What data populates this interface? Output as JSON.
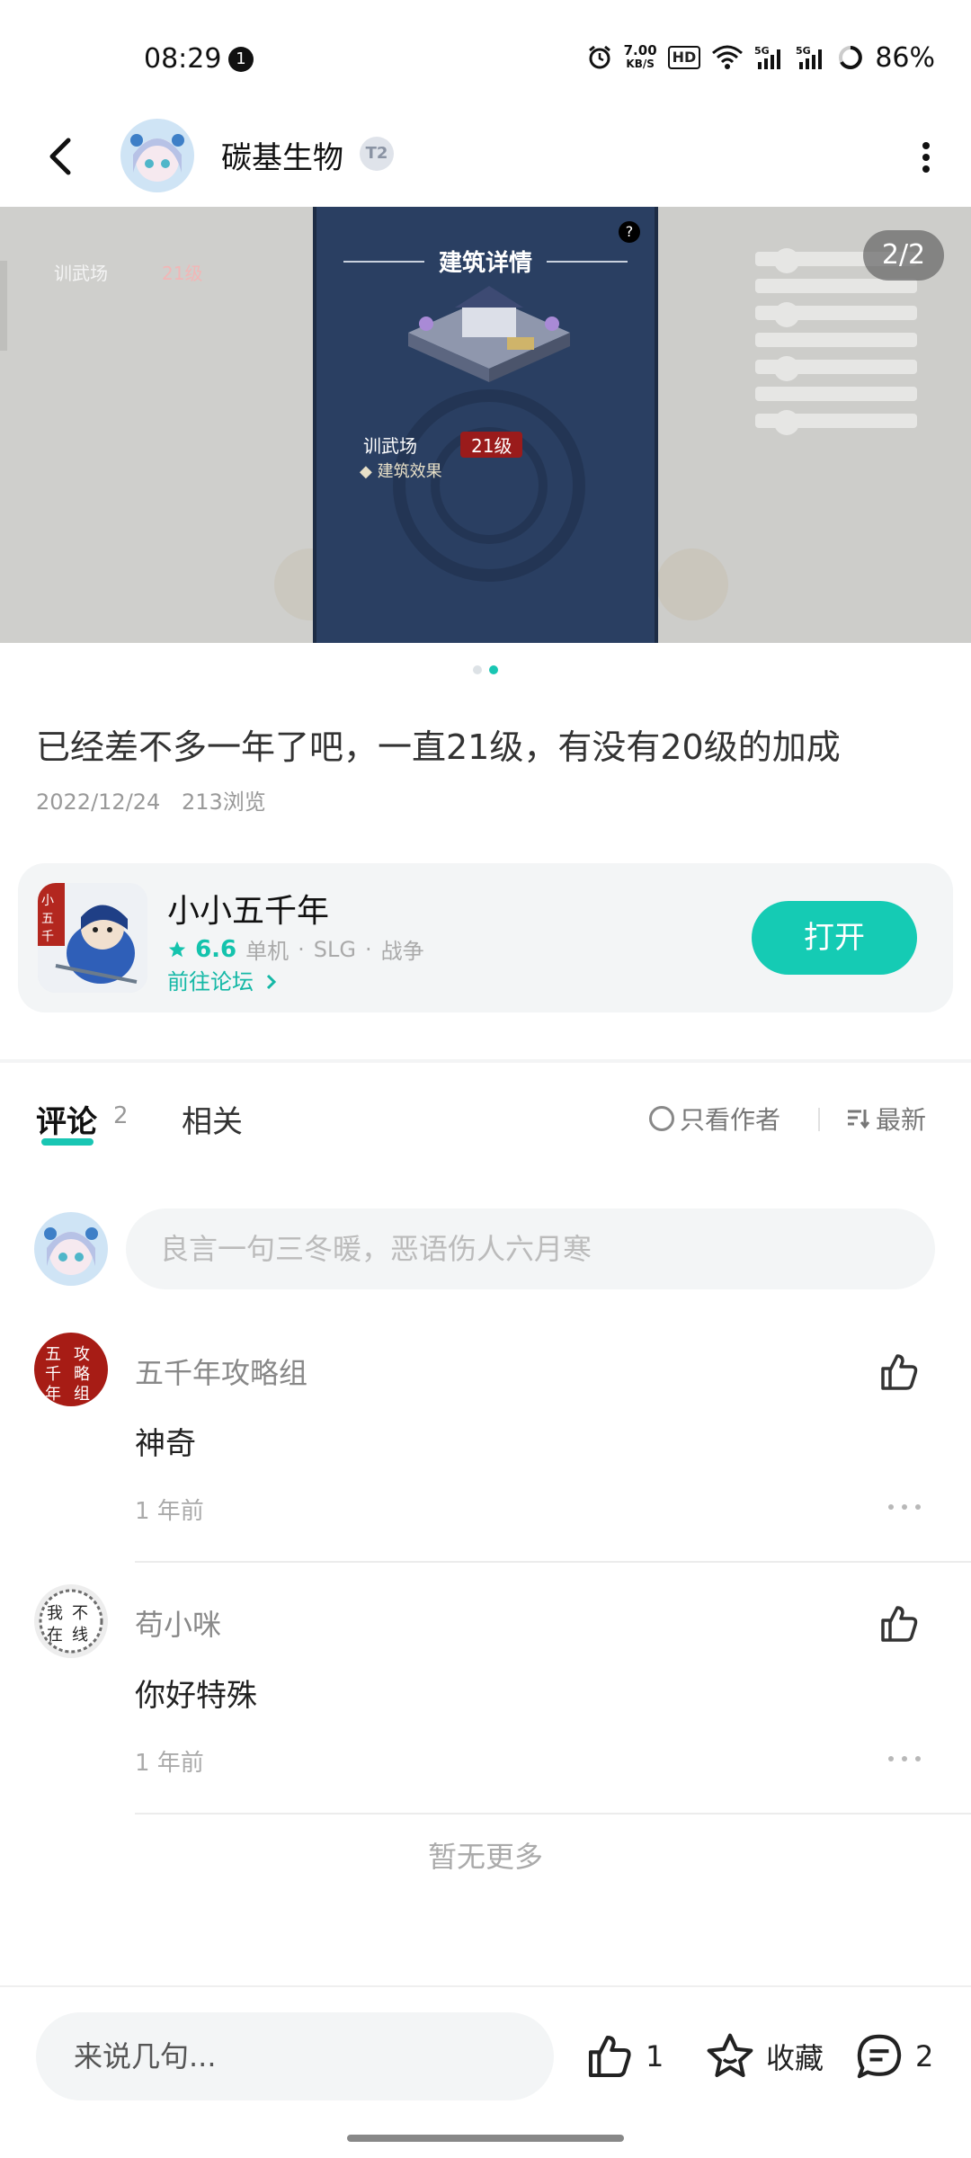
{
  "status_bar": {
    "time": "08:29",
    "notification_count": "1",
    "net_speed": "7.00",
    "net_speed_unit": "KB/S",
    "hd_label": "HD",
    "battery": "86%"
  },
  "header": {
    "title": "碳基生物",
    "badge": "T2"
  },
  "banner": {
    "counter": "2/2",
    "panel_title": "建筑详情",
    "building_name": "训武场",
    "building_level": "21级",
    "building_effect": "建筑效果",
    "bg_label": "训武场",
    "bg_level": "21级",
    "dots_active_index": 1
  },
  "post": {
    "text": "已经差不多一年了吧，一直21级，有没有20级的加成",
    "date": "2022/12/24",
    "views": "213浏览"
  },
  "app_card": {
    "name": "小小五千年",
    "rating": "6.6",
    "tags": [
      "单机",
      "SLG",
      "战争"
    ],
    "forum_link": "前往论坛",
    "open_button": "打开"
  },
  "tabs": {
    "comments_label": "评论",
    "comments_count": "2",
    "related_label": "相关",
    "author_only": "只看作者",
    "sort": "最新"
  },
  "comment_input": {
    "placeholder": "良言一句三冬暖，恶语伤人六月寒"
  },
  "comments": [
    {
      "user": "五千年攻略组",
      "body": "神奇",
      "time": "1 年前"
    },
    {
      "user": "苟小咪",
      "body": "你好特殊",
      "time": "1 年前"
    }
  ],
  "no_more": "暂无更多",
  "bottom_bar": {
    "say_placeholder": "来说几句...",
    "like_count": "1",
    "favorite_label": "收藏",
    "comment_count": "2"
  },
  "colors": {
    "accent": "#15cbb4",
    "level_badge": "#9a1b1b",
    "panel_bg": "#2a3f62"
  }
}
